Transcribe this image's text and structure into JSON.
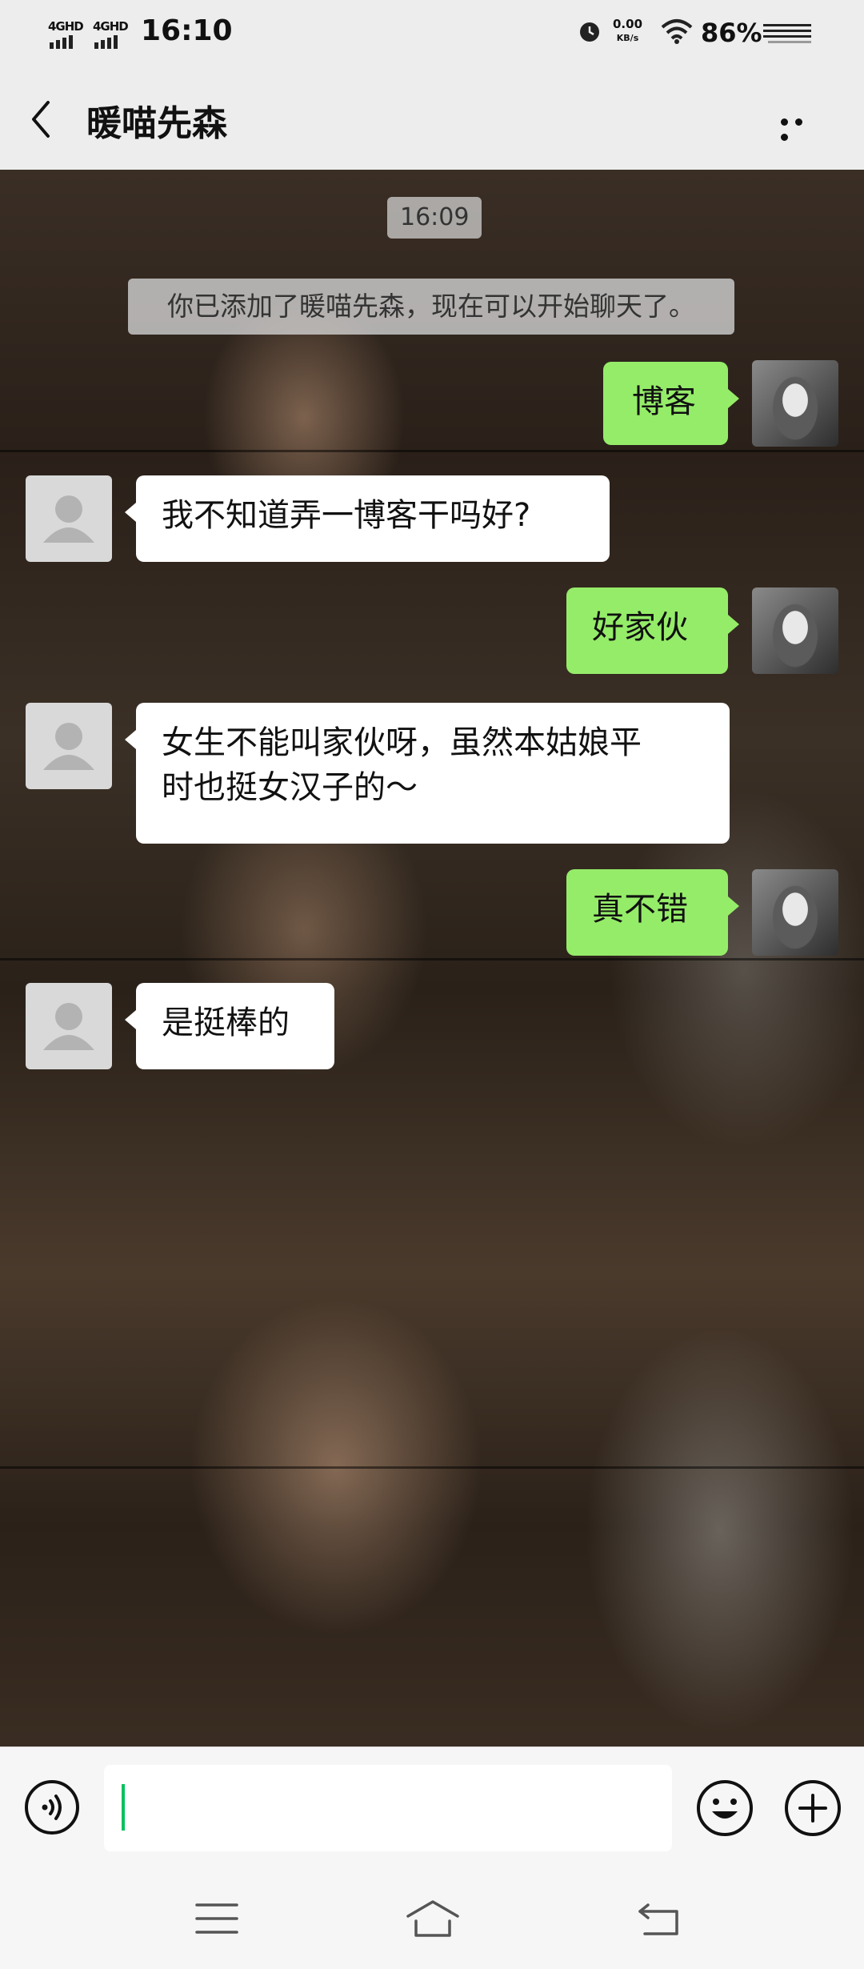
{
  "status_bar": {
    "network_1": "4GHD",
    "network_2": "4GHD",
    "time": "16:10",
    "speed_value": "0.00",
    "speed_unit": "KB/s",
    "battery": "86%"
  },
  "header": {
    "title": "暖喵先森"
  },
  "chat": {
    "time_chip": "16:09",
    "system_message": "你已添加了暖喵先森，现在可以开始聊天了。",
    "messages": [
      {
        "from": "me",
        "text": "博客"
      },
      {
        "from": "them",
        "text": "我不知道弄一博客干吗好?"
      },
      {
        "from": "me",
        "text": "好家伙"
      },
      {
        "from": "them",
        "line1": "女生不能叫家伙呀，虽然本姑娘平",
        "line2": "时也挺女汉子的～"
      },
      {
        "from": "me",
        "text": "真不错"
      },
      {
        "from": "them",
        "text": "是挺棒的"
      }
    ]
  },
  "input_bar": {
    "value": ""
  },
  "colors": {
    "outgoing_bubble": "#95ec69",
    "incoming_bubble": "#ffffff",
    "cursor": "#07c160"
  }
}
